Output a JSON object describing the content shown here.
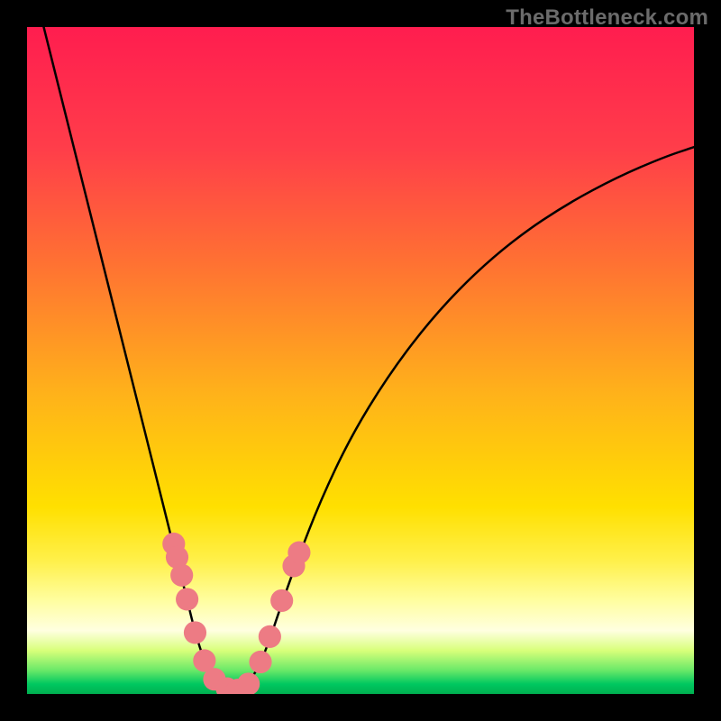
{
  "watermark": {
    "text": "TheBottleneck.com"
  },
  "chart_data": {
    "type": "line",
    "title": "",
    "xlabel": "",
    "ylabel": "",
    "xlim": [
      0,
      1
    ],
    "ylim": [
      0,
      1
    ],
    "gradient_stops": [
      {
        "offset": 0.0,
        "color": "#ff1d4f"
      },
      {
        "offset": 0.18,
        "color": "#ff3d4a"
      },
      {
        "offset": 0.35,
        "color": "#ff7033"
      },
      {
        "offset": 0.55,
        "color": "#ffb21a"
      },
      {
        "offset": 0.72,
        "color": "#ffe000"
      },
      {
        "offset": 0.8,
        "color": "#fff04a"
      },
      {
        "offset": 0.86,
        "color": "#fffea0"
      },
      {
        "offset": 0.905,
        "color": "#ffffe0"
      },
      {
        "offset": 0.935,
        "color": "#d8ff7a"
      },
      {
        "offset": 0.965,
        "color": "#68e868"
      },
      {
        "offset": 0.985,
        "color": "#00c860"
      },
      {
        "offset": 1.0,
        "color": "#00b050"
      }
    ],
    "series": [
      {
        "name": "left-curve",
        "stroke": "#000000",
        "points": [
          {
            "x": 0.025,
            "y": 1.0
          },
          {
            "x": 0.045,
            "y": 0.92
          },
          {
            "x": 0.065,
            "y": 0.84
          },
          {
            "x": 0.085,
            "y": 0.76
          },
          {
            "x": 0.105,
            "y": 0.68
          },
          {
            "x": 0.125,
            "y": 0.6
          },
          {
            "x": 0.145,
            "y": 0.52
          },
          {
            "x": 0.165,
            "y": 0.44
          },
          {
            "x": 0.185,
            "y": 0.36
          },
          {
            "x": 0.205,
            "y": 0.28
          },
          {
            "x": 0.225,
            "y": 0.2
          },
          {
            "x": 0.238,
            "y": 0.15
          },
          {
            "x": 0.25,
            "y": 0.1
          },
          {
            "x": 0.262,
            "y": 0.06
          },
          {
            "x": 0.273,
            "y": 0.035
          },
          {
            "x": 0.285,
            "y": 0.018
          },
          {
            "x": 0.297,
            "y": 0.008
          },
          {
            "x": 0.31,
            "y": 0.003
          }
        ]
      },
      {
        "name": "right-curve",
        "stroke": "#000000",
        "points": [
          {
            "x": 0.31,
            "y": 0.003
          },
          {
            "x": 0.325,
            "y": 0.01
          },
          {
            "x": 0.342,
            "y": 0.03
          },
          {
            "x": 0.36,
            "y": 0.07
          },
          {
            "x": 0.38,
            "y": 0.13
          },
          {
            "x": 0.405,
            "y": 0.2
          },
          {
            "x": 0.44,
            "y": 0.29
          },
          {
            "x": 0.485,
            "y": 0.385
          },
          {
            "x": 0.54,
            "y": 0.475
          },
          {
            "x": 0.6,
            "y": 0.555
          },
          {
            "x": 0.665,
            "y": 0.625
          },
          {
            "x": 0.735,
            "y": 0.685
          },
          {
            "x": 0.81,
            "y": 0.735
          },
          {
            "x": 0.885,
            "y": 0.775
          },
          {
            "x": 0.955,
            "y": 0.805
          },
          {
            "x": 1.0,
            "y": 0.82
          }
        ]
      }
    ],
    "marker_color": "#ed7b84",
    "marker_radius_frac": 0.017,
    "markers": [
      {
        "x": 0.22,
        "y": 0.225
      },
      {
        "x": 0.225,
        "y": 0.205
      },
      {
        "x": 0.232,
        "y": 0.178
      },
      {
        "x": 0.24,
        "y": 0.142
      },
      {
        "x": 0.252,
        "y": 0.092
      },
      {
        "x": 0.266,
        "y": 0.05
      },
      {
        "x": 0.281,
        "y": 0.022
      },
      {
        "x": 0.3,
        "y": 0.008
      },
      {
        "x": 0.316,
        "y": 0.006
      },
      {
        "x": 0.332,
        "y": 0.015
      },
      {
        "x": 0.35,
        "y": 0.048
      },
      {
        "x": 0.364,
        "y": 0.086
      },
      {
        "x": 0.382,
        "y": 0.14
      },
      {
        "x": 0.4,
        "y": 0.192
      },
      {
        "x": 0.408,
        "y": 0.212
      }
    ]
  }
}
